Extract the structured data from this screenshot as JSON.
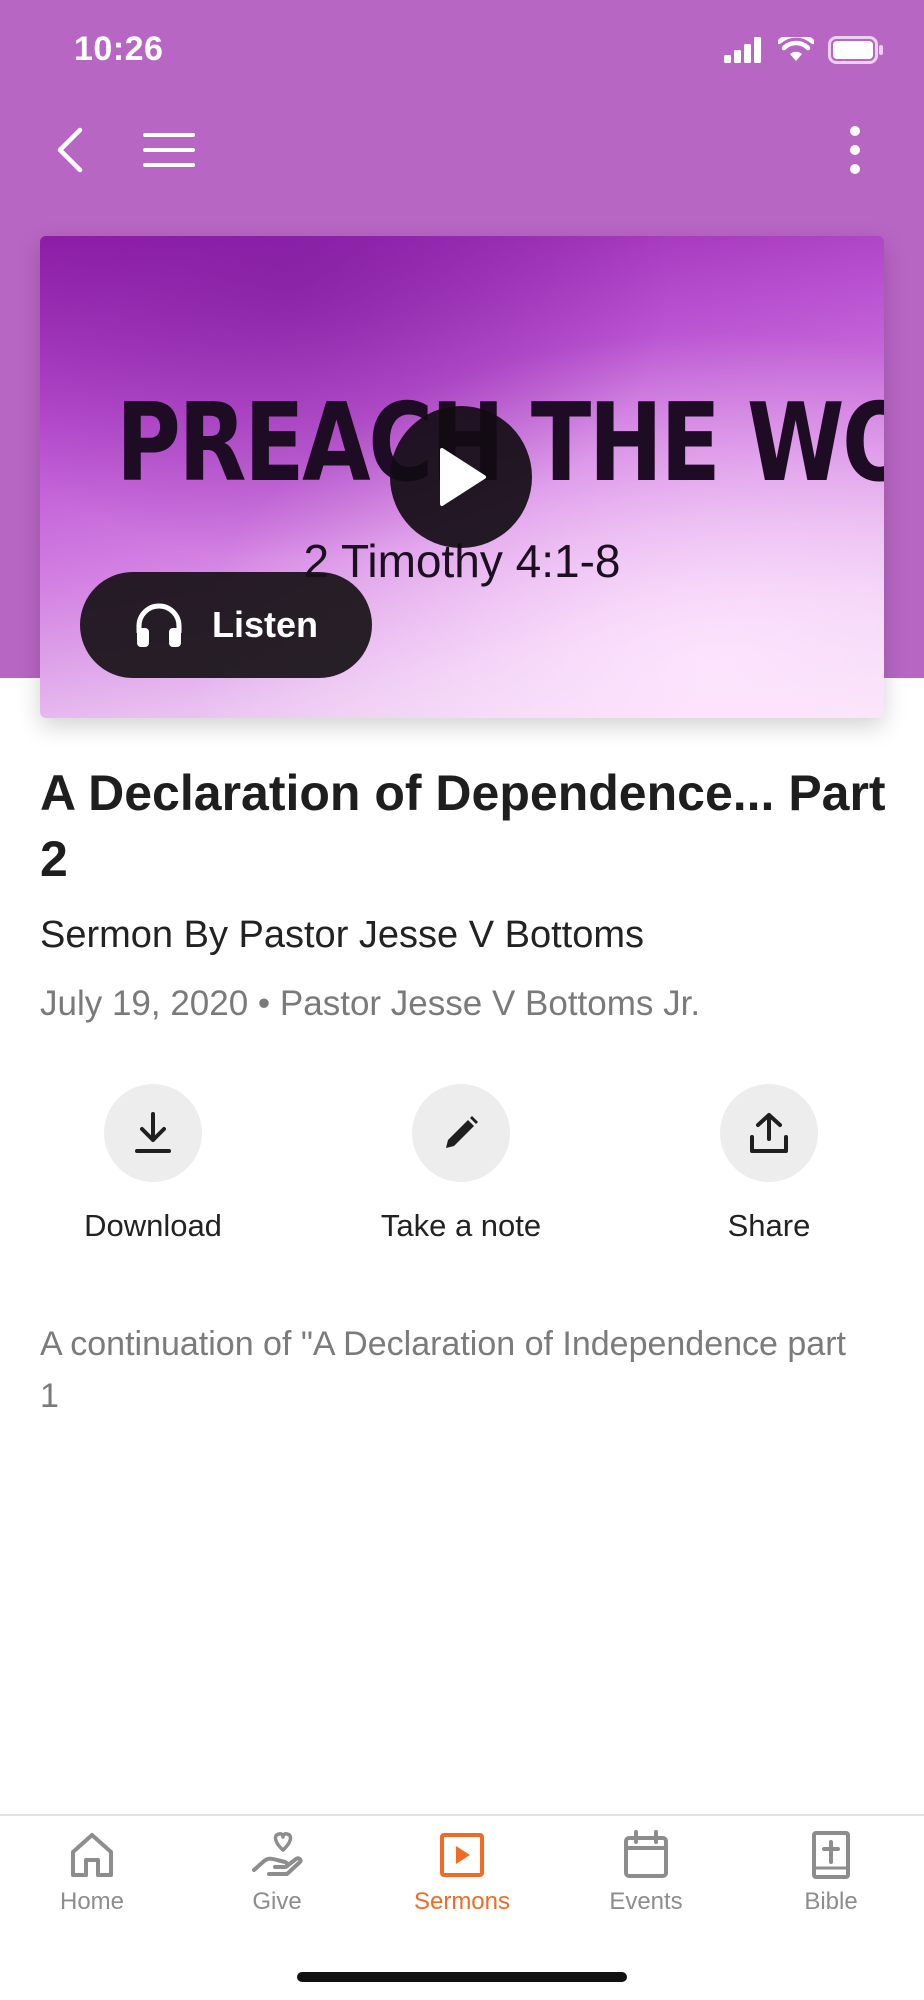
{
  "theme": {
    "header_color": "#b866c4",
    "accent": "#f06b24",
    "tab_inactive": "#8d8d8d"
  },
  "status_bar": {
    "time": "10:26",
    "icons": [
      "signal-icon",
      "wifi-icon",
      "battery-icon"
    ]
  },
  "nav": {
    "icons": [
      "back-chevron-icon",
      "hamburger-menu-icon",
      "more-vertical-icon"
    ]
  },
  "hero": {
    "image_title": "PREACH THE WORD",
    "image_subtitle": "2 Timothy 4:1-8",
    "listen_label": "Listen"
  },
  "sermon": {
    "title": "A Declaration of Dependence... Part 2",
    "subtitle": "Sermon By Pastor Jesse V Bottoms",
    "meta": "July 19, 2020 • Pastor Jesse V Bottoms Jr.",
    "description": "A continuation of \"A Declaration of Independence part 1"
  },
  "actions": [
    {
      "label": "Download",
      "icon": "download-icon"
    },
    {
      "label": "Take a note",
      "icon": "pencil-icon"
    },
    {
      "label": "Share",
      "icon": "share-icon"
    }
  ],
  "tabs": [
    {
      "label": "Home",
      "icon": "home-icon",
      "active": false
    },
    {
      "label": "Give",
      "icon": "give-icon",
      "active": false
    },
    {
      "label": "Sermons",
      "icon": "sermons-icon",
      "active": true
    },
    {
      "label": "Events",
      "icon": "calendar-icon",
      "active": false
    },
    {
      "label": "Bible",
      "icon": "bible-icon",
      "active": false
    }
  ]
}
